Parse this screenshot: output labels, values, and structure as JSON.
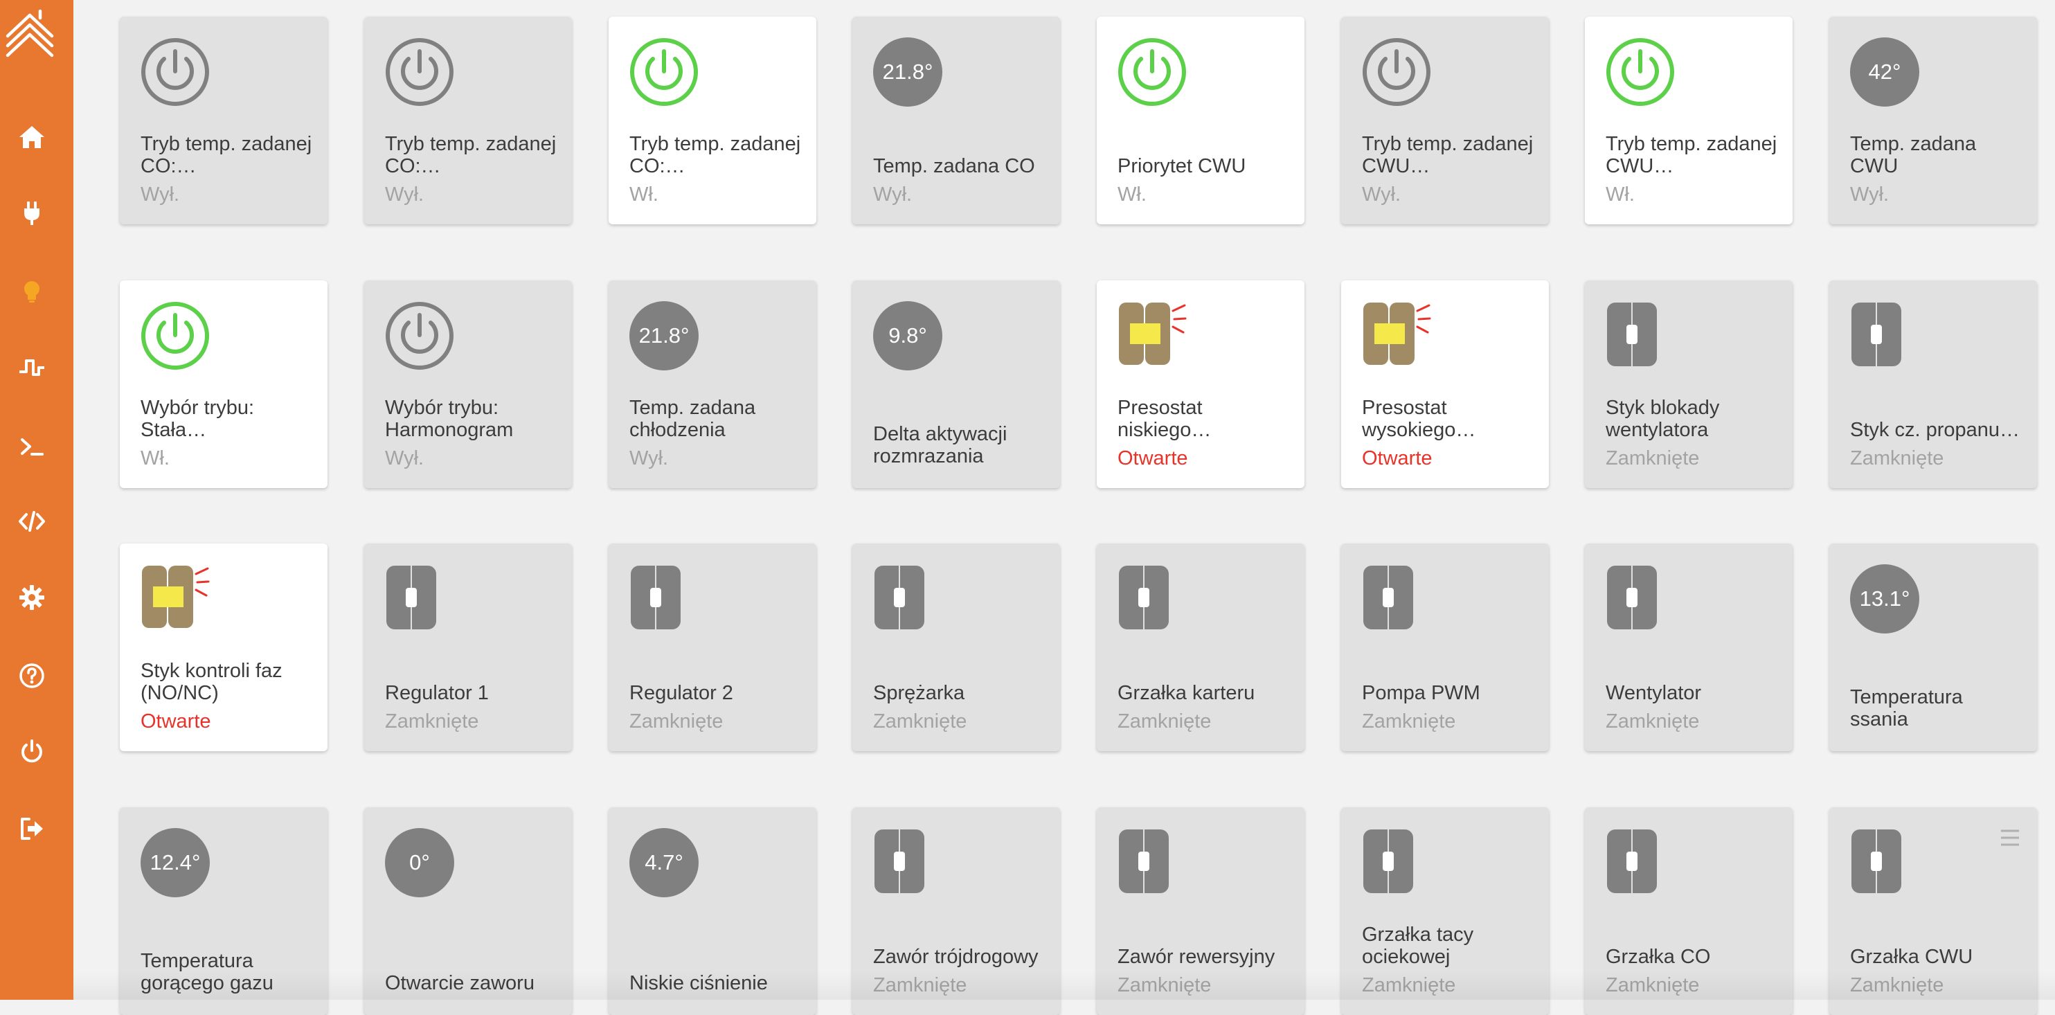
{
  "sidebar": {
    "items": [
      {
        "icon": "home-icon"
      },
      {
        "icon": "plug-icon"
      },
      {
        "icon": "lightbulb-icon"
      },
      {
        "icon": "pulse-icon"
      },
      {
        "icon": "terminal-icon"
      },
      {
        "icon": "code-icon"
      },
      {
        "icon": "gear-icon"
      },
      {
        "icon": "help-icon"
      },
      {
        "icon": "power-icon"
      },
      {
        "icon": "logout-icon"
      }
    ]
  },
  "colors": {
    "accent": "#e87830",
    "active": "#5bd048",
    "inactive": "#808080",
    "alert": "#e8332a",
    "tile_on": "#ffffff",
    "tile_off": "#e1e1e1"
  },
  "rows": [
    {
      "tiles": [
        {
          "type": "power",
          "on": false,
          "name": "Tryb temp. zadanej CO:…",
          "state": "Wył."
        },
        {
          "type": "power",
          "on": false,
          "name": "Tryb temp. zadanej CO:…",
          "state": "Wył."
        },
        {
          "type": "power",
          "on": true,
          "name": "Tryb temp. zadanej CO:…",
          "state": "Wł."
        },
        {
          "type": "value",
          "on": false,
          "badge": "21.8°",
          "name": "Temp. zadana CO",
          "state": "Wył."
        },
        {
          "type": "power",
          "on": true,
          "name": "Priorytet CWU",
          "state": "Wł."
        },
        {
          "type": "power",
          "on": false,
          "name": "Tryb temp. zadanej CWU…",
          "state": "Wył."
        },
        {
          "type": "power",
          "on": true,
          "name": "Tryb temp. zadanej CWU…",
          "state": "Wł."
        },
        {
          "type": "value",
          "on": false,
          "badge": "42°",
          "name": "Temp. zadana CWU",
          "state": "Wył."
        }
      ]
    },
    {
      "tiles": [
        {
          "type": "power",
          "on": true,
          "name": "Wybór trybu: Stała…",
          "state": "Wł."
        },
        {
          "type": "power",
          "on": false,
          "name": "Wybór trybu: Harmonogram",
          "state": "Wył."
        },
        {
          "type": "value",
          "on": false,
          "badge": "21.8°",
          "name": "Temp. zadana chłodzenia",
          "state": "Wył."
        },
        {
          "type": "value",
          "on": false,
          "badge": "9.8°",
          "name": "Delta aktywacji rozmrazania",
          "state": ""
        },
        {
          "type": "door",
          "on": true,
          "name": "Presostat niskiego…",
          "state": "Otwarte",
          "alert": true
        },
        {
          "type": "door",
          "on": true,
          "name": "Presostat wysokiego…",
          "state": "Otwarte",
          "alert": true
        },
        {
          "type": "door",
          "on": false,
          "name": "Styk blokady wentylatora",
          "state": "Zamknięte"
        },
        {
          "type": "door",
          "on": false,
          "name": "Styk cz. propanu…",
          "state": "Zamknięte"
        }
      ]
    },
    {
      "tiles": [
        {
          "type": "door",
          "on": true,
          "name": "Styk kontroli faz (NO/NC)",
          "state": "Otwarte",
          "alert": true
        },
        {
          "type": "door",
          "on": false,
          "name": "Regulator 1",
          "state": "Zamknięte"
        },
        {
          "type": "door",
          "on": false,
          "name": "Regulator 2",
          "state": "Zamknięte"
        },
        {
          "type": "door",
          "on": false,
          "name": "Sprężarka",
          "state": "Zamknięte"
        },
        {
          "type": "door",
          "on": false,
          "name": "Grzałka karteru",
          "state": "Zamknięte"
        },
        {
          "type": "door",
          "on": false,
          "name": "Pompa PWM",
          "state": "Zamknięte"
        },
        {
          "type": "door",
          "on": false,
          "name": "Wentylator",
          "state": "Zamknięte"
        },
        {
          "type": "value",
          "on": false,
          "badge": "13.1°",
          "name": "Temperatura ssania",
          "state": ""
        }
      ]
    },
    {
      "tiles": [
        {
          "type": "value",
          "on": false,
          "badge": "12.4°",
          "name": "Temperatura gorącego gazu",
          "state": ""
        },
        {
          "type": "value",
          "on": false,
          "badge": "0°",
          "name": "Otwarcie zaworu",
          "state": ""
        },
        {
          "type": "value",
          "on": false,
          "badge": "4.7°",
          "name": "Niskie ciśnienie",
          "state": ""
        },
        {
          "type": "door",
          "on": false,
          "name": "Zawór trójdrogowy",
          "state": "Zamknięte"
        },
        {
          "type": "door",
          "on": false,
          "name": "Zawór rewersyjny",
          "state": "Zamknięte"
        },
        {
          "type": "door",
          "on": false,
          "name": "Grzałka tacy ociekowej",
          "state": "Zamknięte"
        },
        {
          "type": "door",
          "on": false,
          "name": "Grzałka CO",
          "state": "Zamknięte"
        },
        {
          "type": "door",
          "on": false,
          "name": "Grzałka CWU",
          "state": "Zamknięte",
          "menu": "menu-icon"
        }
      ]
    }
  ]
}
